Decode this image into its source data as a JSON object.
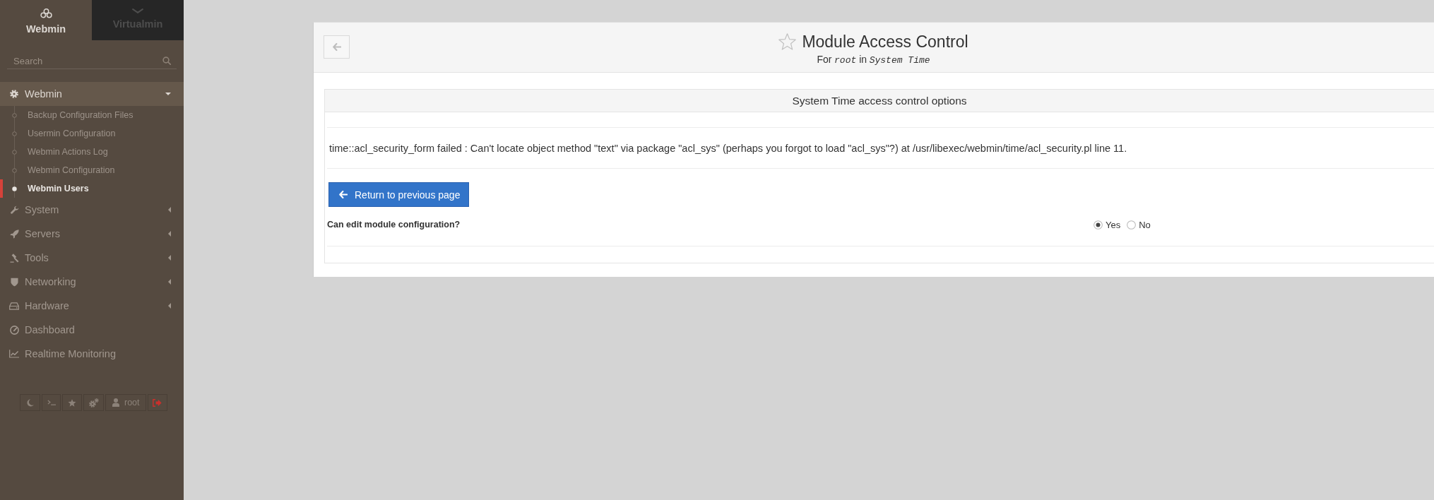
{
  "sidebar": {
    "tabs": [
      {
        "label": "Webmin",
        "selected": true
      },
      {
        "label": "Virtualmin",
        "selected": false
      }
    ],
    "search": {
      "placeholder": "Search"
    },
    "categories": [
      {
        "label": "Webmin",
        "expanded": true,
        "children": [
          {
            "label": "Backup Configuration Files",
            "selected": false
          },
          {
            "label": "Usermin Configuration",
            "selected": false
          },
          {
            "label": "Webmin Actions Log",
            "selected": false
          },
          {
            "label": "Webmin Configuration",
            "selected": false
          },
          {
            "label": "Webmin Users",
            "selected": true
          }
        ]
      },
      {
        "label": "System",
        "expanded": false
      },
      {
        "label": "Servers",
        "expanded": false
      },
      {
        "label": "Tools",
        "expanded": false
      },
      {
        "label": "Networking",
        "expanded": false
      },
      {
        "label": "Hardware",
        "expanded": false
      }
    ],
    "links": [
      {
        "label": "Dashboard"
      },
      {
        "label": "Realtime Monitoring"
      }
    ],
    "user": "root"
  },
  "page": {
    "starred": false,
    "title": "Module Access Control",
    "subtitle": [
      {
        "text": "For",
        "kind": "plain"
      },
      {
        "text": "root",
        "kind": "code"
      },
      {
        "text": "in",
        "kind": "plain"
      },
      {
        "text": "System Time",
        "kind": "code"
      }
    ],
    "table": {
      "title": "System Time access control options",
      "error": "time::acl_security_form failed : Can't locate object method \"text\" via package \"acl_sys\" (perhaps you forgot to load \"acl_sys\"?) at /usr/libexec/webmin/time/acl_security.pl line 11.",
      "return_button": "Return to previous page",
      "fields": [
        {
          "label": "Can edit module configuration?",
          "options": [
            {
              "label": "Yes",
              "selected": true
            },
            {
              "label": "No",
              "selected": false
            }
          ]
        }
      ]
    }
  }
}
